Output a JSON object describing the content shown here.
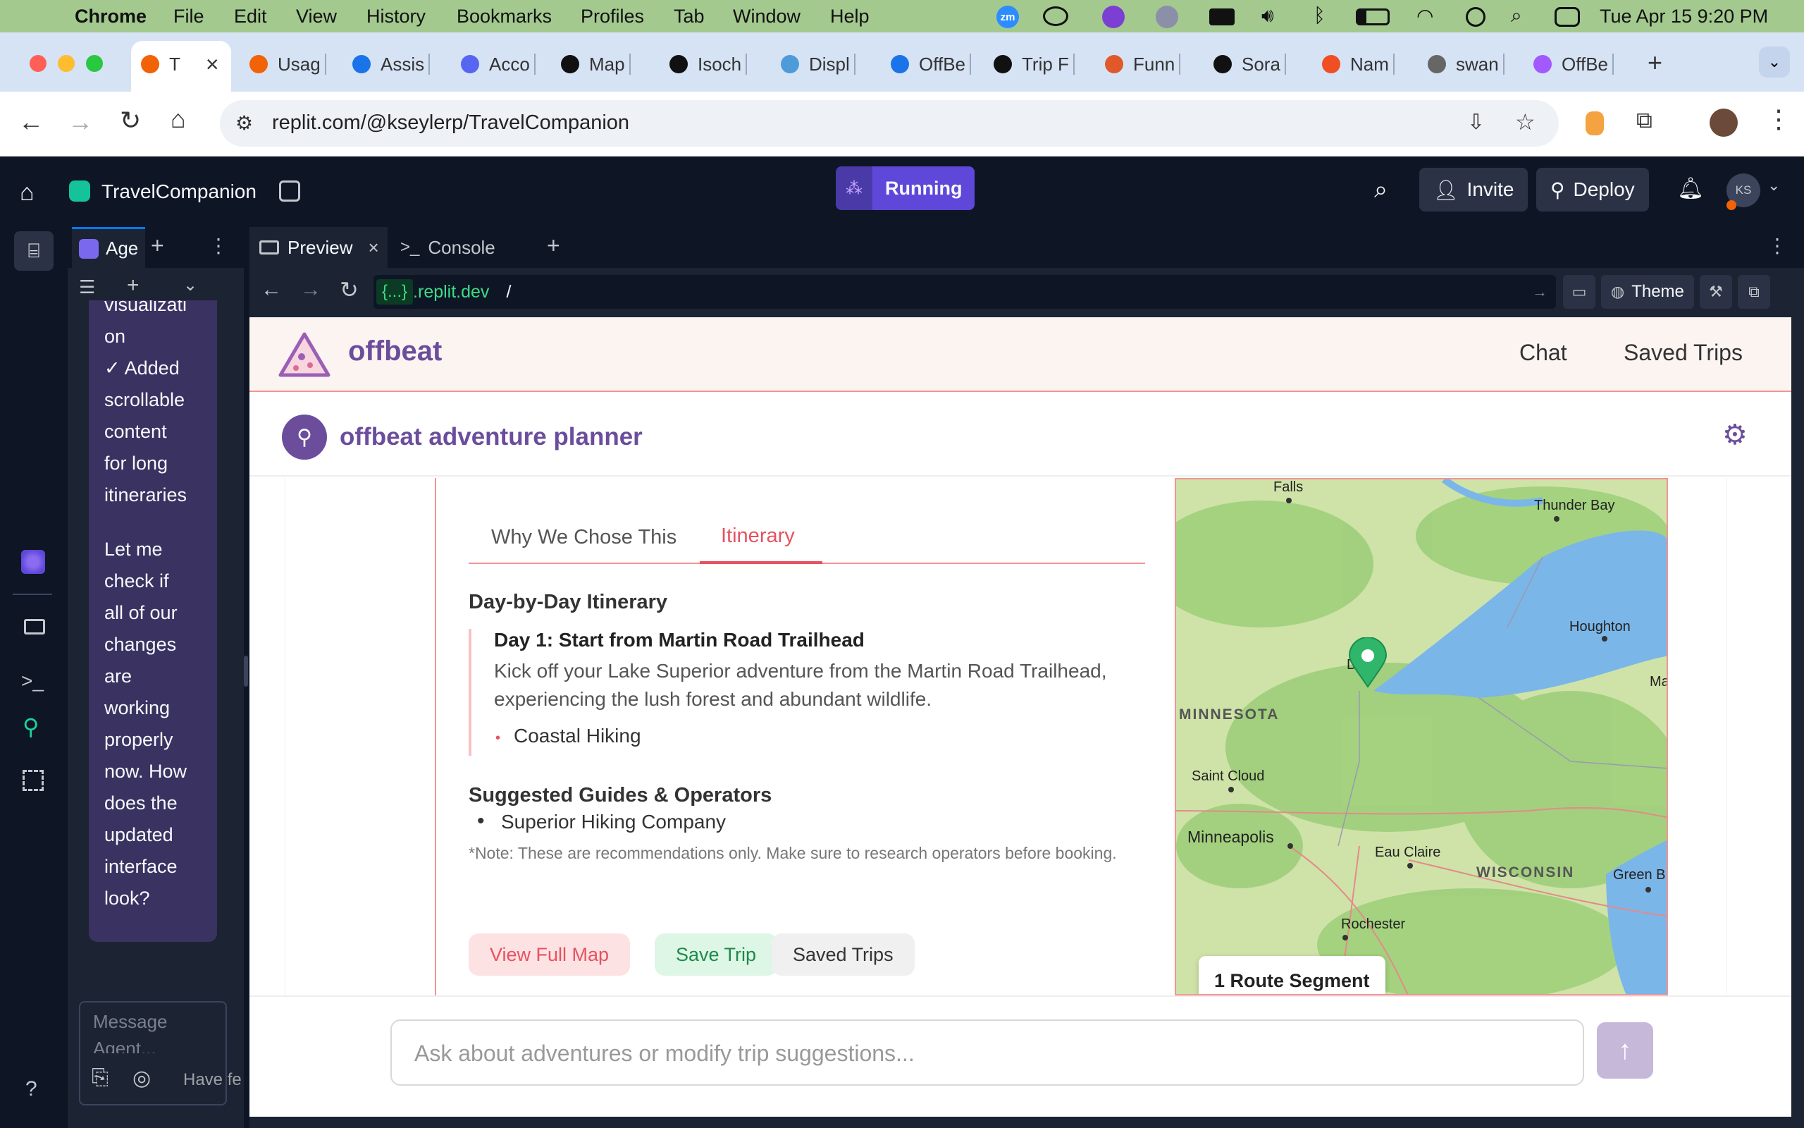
{
  "menubar": {
    "app": "Chrome",
    "items": [
      "File",
      "Edit",
      "View",
      "History",
      "Bookmarks",
      "Profiles",
      "Tab",
      "Window",
      "Help"
    ],
    "datetime": "Tue Apr 15  9:20 PM",
    "zoom_badge": "zm"
  },
  "browser": {
    "tabs": [
      {
        "label": "T",
        "color": "#f26207"
      },
      {
        "label": "Usag",
        "color": "#f26207"
      },
      {
        "label": "Assis",
        "color": "#1a73e8"
      },
      {
        "label": "Acco",
        "color": "#5865f2"
      },
      {
        "label": "Map",
        "color": "#111111"
      },
      {
        "label": "Isoch",
        "color": "#111111"
      },
      {
        "label": "Displ",
        "color": "#4e9bd9"
      },
      {
        "label": "OffBe",
        "color": "#1a73e8"
      },
      {
        "label": "Trip F",
        "color": "#111111"
      },
      {
        "label": "Funn",
        "color": "#e0592a"
      },
      {
        "label": "Sora",
        "color": "#111111"
      },
      {
        "label": "Nam",
        "color": "#f04e23"
      },
      {
        "label": "swan",
        "color": "#666666"
      },
      {
        "label": "OffBe",
        "color": "#a259ff"
      }
    ],
    "url": "replit.com/@kseylerp/TravelCompanion"
  },
  "replit": {
    "project_name": "TravelCompanion",
    "run_status": "Running",
    "invite_label": "Invite",
    "deploy_label": "Deploy",
    "avatar_initials": "KS",
    "agent_tab_label": "Age",
    "preview_tab_label": "Preview",
    "console_tab_label": "Console",
    "dev_domain_prefix": "{...}",
    "dev_domain_suffix": ".replit.dev",
    "dev_path": "/",
    "theme_label": "Theme",
    "agent_message_lines": [
      "visualizati",
      "on",
      "✓ Added",
      "scrollable",
      "content",
      "for long",
      "itineraries"
    ],
    "agent_message_lines_2": [
      "Let me",
      "check if",
      "all of our",
      "changes",
      "are",
      "working",
      "properly",
      "now. How",
      "does the",
      "updated",
      "interface",
      "look?"
    ],
    "message_placeholder_1": "Message",
    "message_placeholder_2": "Agent...",
    "feedback_text": "Have fe"
  },
  "app": {
    "logo_text": "offbeat",
    "nav": [
      "Chat",
      "Saved Trips"
    ],
    "planner_title": "offbeat adventure planner",
    "tabs": [
      "Why We Chose This",
      "Itinerary"
    ],
    "active_tab": "Itinerary",
    "section_title": "Day-by-Day Itinerary",
    "day_title": "Day 1: Start from Martin Road Trailhead",
    "day_description": "Kick off your Lake Superior adventure from the Martin Road Trailhead, experiencing the lush forest and abundant wildlife.",
    "day_activities": [
      "Coastal Hiking"
    ],
    "guides_title": "Suggested Guides & Operators",
    "guides": [
      "Superior Hiking Company"
    ],
    "note": "*Note: These are recommendations only. Make sure to research operators before booking.",
    "buttons": [
      "View Full Map",
      "Save Trip",
      "Saved Trips"
    ],
    "chat_placeholder": "Ask about adventures or modify trip suggestions...",
    "map": {
      "route_badge": "1 Route Segment",
      "labels": [
        "Falls",
        "Thunder Bay",
        "Houghton",
        "Ma",
        "Du  h",
        "MINNESOTA",
        "Saint Cloud",
        "Minneapolis",
        "Eau Claire",
        "WISCONSIN",
        "Green B",
        "Rochester"
      ]
    }
  }
}
